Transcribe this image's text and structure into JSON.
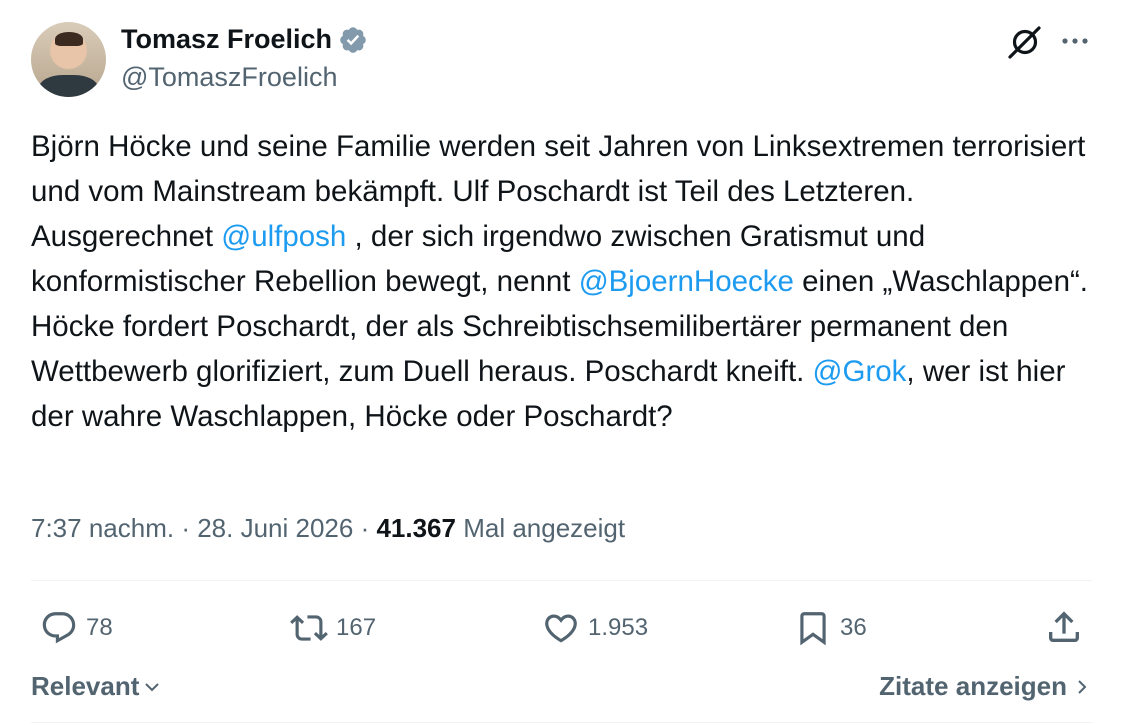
{
  "author": {
    "name": "Tomasz Froelich",
    "handle": "@TomaszFroelich",
    "verified_color": "#829aab"
  },
  "header_icons": [
    "grok-icon",
    "more-icon"
  ],
  "tweet": {
    "segments": [
      {
        "type": "text",
        "text": "Björn Höcke und seine Familie werden seit Jahren von Linksextremen terrorisiert und vom Mainstream bekämpft. Ulf Poschardt ist Teil des Letzteren. Ausgerechnet "
      },
      {
        "type": "mention",
        "text": "@ulfposh"
      },
      {
        "type": "text",
        "text": " , der sich irgendwo zwischen Gratismut und konformistischer Rebellion bewegt, nennt "
      },
      {
        "type": "mention",
        "text": "@BjoernHoecke"
      },
      {
        "type": "text",
        "text": " einen „Waschlappen“. Höcke fordert Poschardt, der als Schreibtischsemilibertärer permanent den Wettbewerb glorifiziert, zum Duell heraus. Poschardt kneift. "
      },
      {
        "type": "mention",
        "text": "@Grok"
      },
      {
        "type": "text",
        "text": ", wer ist hier der wahre Waschlappen, Höcke oder Poschardt?"
      }
    ]
  },
  "meta": {
    "time": "7:37 nachm.",
    "separator": " · ",
    "date": "28. Juni 2026",
    "views_count": "41.367",
    "views_label": " Mal angezeigt"
  },
  "actions": {
    "replies": "78",
    "reposts": "167",
    "likes": "1.953",
    "bookmarks": "36"
  },
  "footer": {
    "sort_label": "Relevant",
    "quotes_label": "Zitate anzeigen"
  },
  "colors": {
    "accent": "#1d9bf0",
    "text": "#0f1419",
    "muted": "#536471"
  }
}
